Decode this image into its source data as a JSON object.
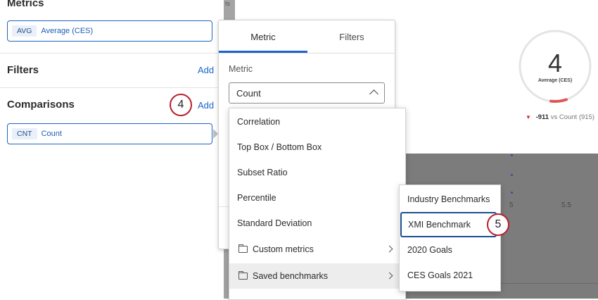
{
  "left_panel": {
    "metrics_title": "Metrics",
    "metric_pill": {
      "tag": "AVG",
      "label": "Average (CES)"
    },
    "filters_title": "Filters",
    "filters_add": "Add",
    "comparisons_title": "Comparisons",
    "comparisons_add": "Add",
    "comparison_pill": {
      "tag": "CNT",
      "label": "Count"
    },
    "step_badge": "4"
  },
  "background": {
    "strip_text": "ts",
    "gauge": {
      "value": "4",
      "label": "Average (CES)"
    },
    "comparison_text": {
      "diff": "-911",
      "rest": "vs Count (915)"
    },
    "x_ticks": [
      "5",
      "5.5"
    ]
  },
  "metric_card": {
    "tabs": [
      {
        "label": "Metric"
      },
      {
        "label": "Filters"
      }
    ],
    "field_label": "Metric",
    "selected_value": "Count"
  },
  "dropdown": {
    "items": [
      {
        "label": "Correlation"
      },
      {
        "label": "Top Box / Bottom Box"
      },
      {
        "label": "Subset Ratio"
      },
      {
        "label": "Percentile"
      },
      {
        "label": "Standard Deviation"
      },
      {
        "label": "Custom metrics",
        "icon": "folder-icon"
      },
      {
        "label": "Saved benchmarks",
        "icon": "folder-icon"
      }
    ]
  },
  "submenu": {
    "items": [
      {
        "label": "Industry Benchmarks"
      },
      {
        "label": "XMI Benchmark"
      },
      {
        "label": "2020 Goals"
      },
      {
        "label": "CES Goals 2021"
      }
    ],
    "step_badge": "5"
  },
  "colors": {
    "accent": "#1d64c4",
    "badge_border": "#b8202b",
    "negative": "#d72b2b",
    "overlay": "#7c7c7c"
  }
}
